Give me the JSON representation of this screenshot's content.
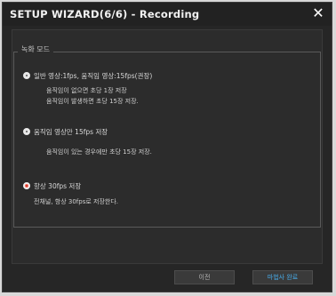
{
  "window": {
    "title": "SETUP WIZARD(6/6) - Recording"
  },
  "group": {
    "legend": "녹화 모드"
  },
  "options": [
    {
      "label": "일반 영상:1fps, 움직임 영상:15fps(권장)",
      "desc": [
        "움직임이 없으면 초당 1장 저장",
        "움직임이 발생하면 초당 15장 저장."
      ],
      "checked": false
    },
    {
      "label": "움직임 영상만 15fps 저장",
      "desc": [
        "움직임이 있는 경우에만 초당 15장 저장."
      ],
      "checked": false
    },
    {
      "label": "항상 30fps 저장",
      "desc": [
        "전채널, 항상 30fps로 저장한다."
      ],
      "checked": true
    }
  ],
  "buttons": {
    "prev": "이전",
    "finish": "마법사 완료"
  },
  "colors": {
    "accent": "#47a9e6",
    "radio_selected": "#ff6a5a"
  }
}
